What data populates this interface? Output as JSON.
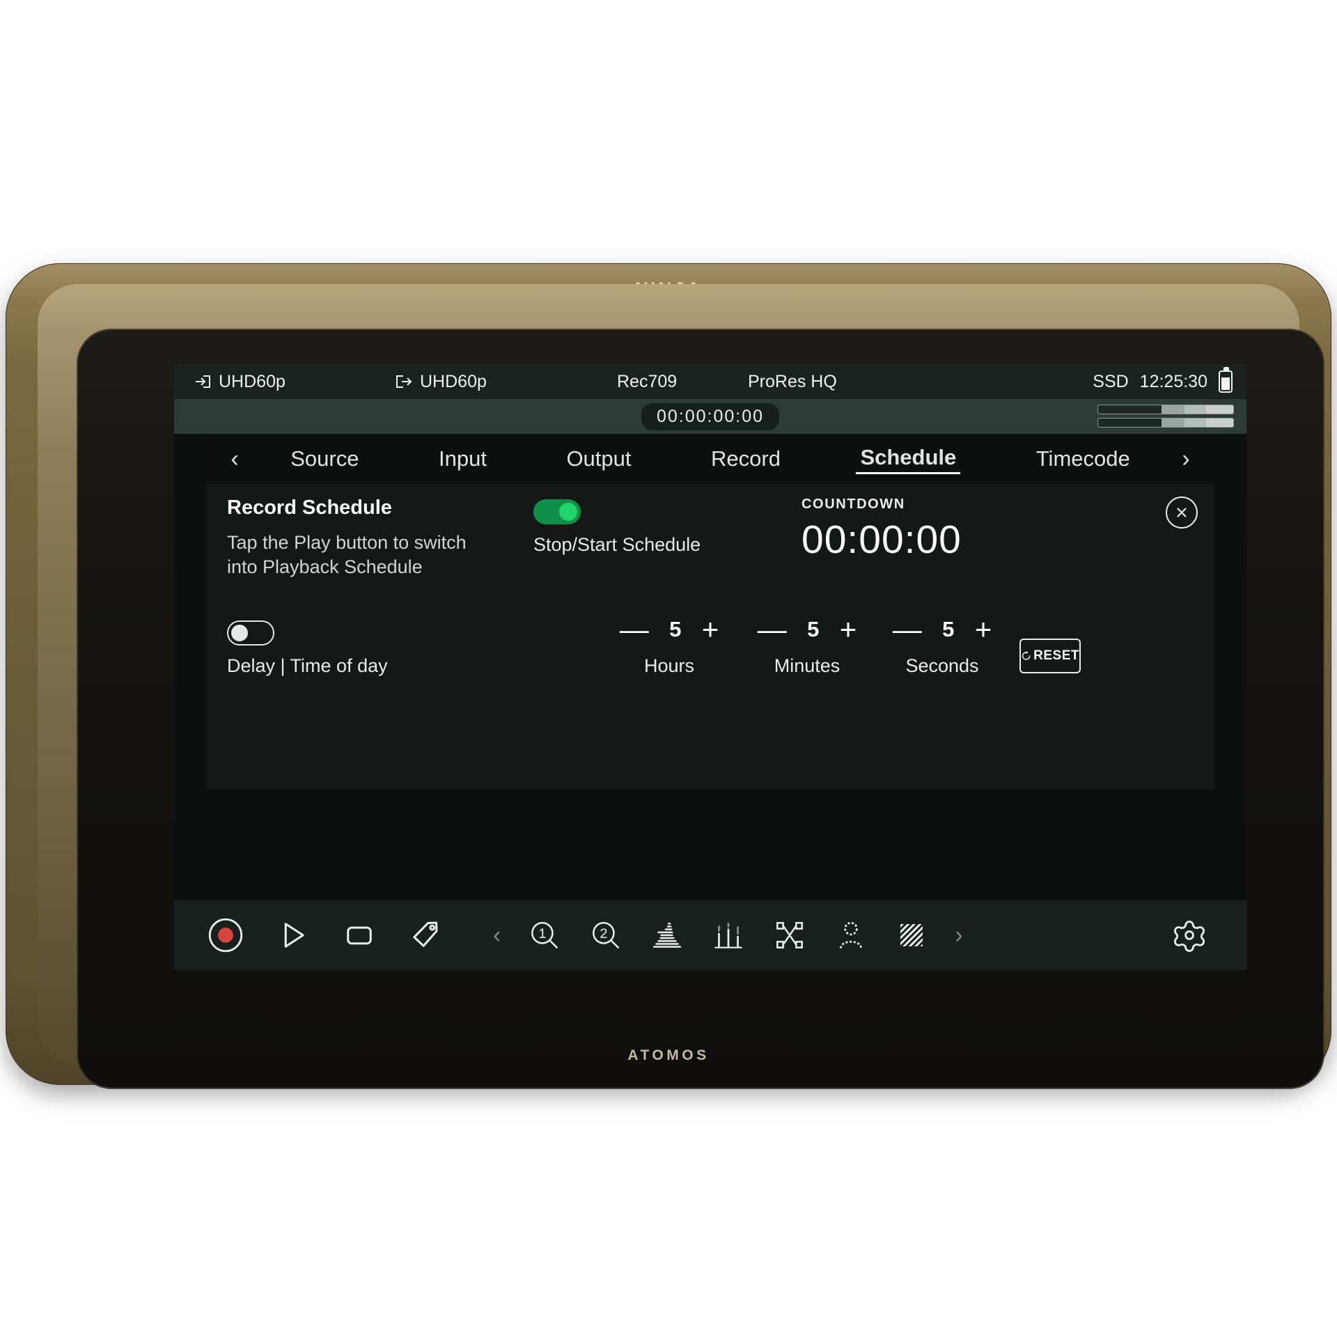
{
  "device": {
    "brand_top": "NINJA",
    "brand_bottom": "ATOMOS"
  },
  "statusbar": {
    "input_label": "UHD60p",
    "output_label": "UHD60p",
    "colorspace": "Rec709",
    "codec": "ProRes HQ",
    "media_label": "SSD",
    "media_time": "12:25:30",
    "input_icon": "input-arrow-icon",
    "output_icon": "output-arrow-icon",
    "battery_icon": "battery-icon"
  },
  "timecodebar": {
    "timecode": "00:00:00:00",
    "meters": [
      "audio-meter-ch1",
      "audio-meter-ch2"
    ]
  },
  "tabs": {
    "prev_icon": "chevron-left-icon",
    "next_icon": "chevron-right-icon",
    "items": [
      {
        "label": "Source",
        "active": false
      },
      {
        "label": "Input",
        "active": false
      },
      {
        "label": "Output",
        "active": false
      },
      {
        "label": "Record",
        "active": false
      },
      {
        "label": "Schedule",
        "active": true
      },
      {
        "label": "Timecode",
        "active": false
      }
    ]
  },
  "panel": {
    "title": "Record Schedule",
    "subtitle": "Tap the Play button to switch into Playback Schedule",
    "stop_start": {
      "label": "Stop/Start Schedule",
      "state": "on",
      "accent": "#0f8f47"
    },
    "countdown": {
      "label": "COUNTDOWN",
      "value": "00:00:00"
    },
    "close_icon": "close-circle-icon",
    "delay": {
      "label": "Delay | Time of day",
      "state": "off"
    },
    "steppers": [
      {
        "name": "Hours",
        "value": "5",
        "minus": "—",
        "plus": "+"
      },
      {
        "name": "Minutes",
        "value": "5",
        "minus": "—",
        "plus": "+"
      },
      {
        "name": "Seconds",
        "value": "5",
        "minus": "—",
        "plus": "+"
      }
    ],
    "reset": {
      "label": "RESET",
      "icon": "reset-loop-icon"
    }
  },
  "toolbar": {
    "record_icon": "record-icon",
    "play_icon": "play-icon",
    "stop_icon": "stop-icon",
    "tag_icon": "tag-icon",
    "prev_icon": "chevron-left-icon",
    "next_icon": "chevron-right-icon",
    "monitor_1_icon": "magnify-1-icon",
    "monitor_2_icon": "magnify-2-icon",
    "waveform_icon": "waveform-icon",
    "vectorscope_icon": "audio-levels-icon",
    "focus_peak_icon": "focus-peaking-icon",
    "skin_tone_icon": "skin-tone-icon",
    "zebra_icon": "zebra-icon",
    "gear_icon": "gear-icon"
  }
}
